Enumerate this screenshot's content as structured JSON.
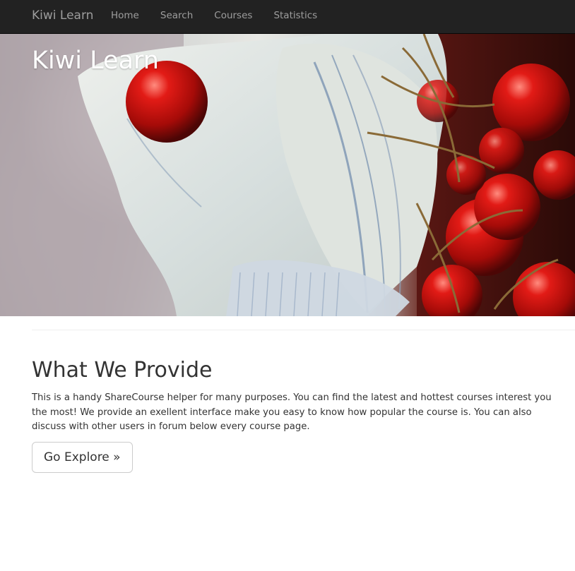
{
  "navbar": {
    "brand": "Kiwi Learn",
    "items": [
      {
        "label": "Home"
      },
      {
        "label": "Search"
      },
      {
        "label": "Courses"
      },
      {
        "label": "Statistics"
      }
    ]
  },
  "hero": {
    "title": "Kiwi Learn",
    "image": "cherries-and-linen-cloth"
  },
  "content": {
    "heading": "What We Provide",
    "body": "This is a handy ShareCourse helper for many purposes. You can find the latest and hottest courses interest you the most! We provide an exellent interface make you easy to know how popular the course is. You can also discuss with other users in forum below every course page.",
    "button_label": "Go Explore »"
  },
  "colors": {
    "navbar_bg": "#222222",
    "nav_text": "#9d9d9d",
    "text": "#333333",
    "button_border": "#cccccc",
    "hero_title": "#ffffff"
  }
}
